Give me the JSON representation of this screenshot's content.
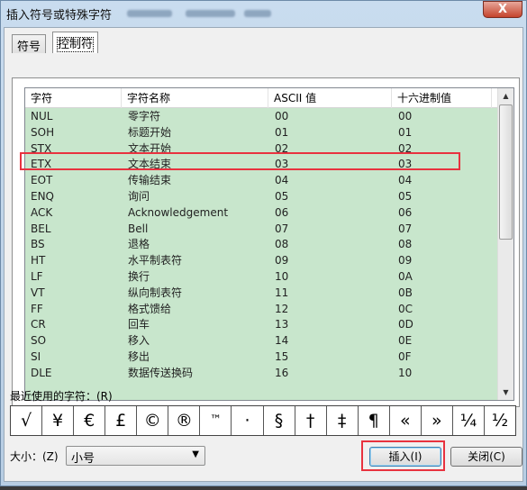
{
  "window": {
    "title": "插入符号或特殊字符",
    "close_label": "X"
  },
  "tabs": [
    {
      "label": "符号",
      "active": false
    },
    {
      "label": "控制符",
      "active": true
    }
  ],
  "list": {
    "columns": [
      "字符",
      "字符名称",
      "ASCII 值",
      "十六进制值"
    ],
    "rows": [
      [
        "NUL",
        "零字符",
        "00",
        "00"
      ],
      [
        "SOH",
        "标题开始",
        "01",
        "01"
      ],
      [
        "STX",
        "文本开始",
        "02",
        "02"
      ],
      [
        "ETX",
        "文本结束",
        "03",
        "03"
      ],
      [
        "EOT",
        "传输结束",
        "04",
        "04"
      ],
      [
        "ENQ",
        "询问",
        "05",
        "05"
      ],
      [
        "ACK",
        "Acknowledgement",
        "06",
        "06"
      ],
      [
        "BEL",
        "Bell",
        "07",
        "07"
      ],
      [
        "BS",
        "退格",
        "08",
        "08"
      ],
      [
        "HT",
        "水平制表符",
        "09",
        "09"
      ],
      [
        "LF",
        "换行",
        "10",
        "0A"
      ],
      [
        "VT",
        "纵向制表符",
        "11",
        "0B"
      ],
      [
        "FF",
        "格式馈给",
        "12",
        "0C"
      ],
      [
        "CR",
        "回车",
        "13",
        "0D"
      ],
      [
        "SO",
        "移入",
        "14",
        "0E"
      ],
      [
        "SI",
        "移出",
        "15",
        "0F"
      ],
      [
        "DLE",
        "数据传送换码",
        "16",
        "10"
      ]
    ],
    "highlighted_row": "EOT",
    "row_background": "#c8e6cc",
    "highlight_color": "#e8323f"
  },
  "recent": {
    "label": "最近使用的字符：(R)",
    "chars": [
      "√",
      "¥",
      "€",
      "£",
      "©",
      "®",
      "™",
      "·",
      "§",
      "†",
      "‡",
      "¶",
      "«",
      "»",
      "¼",
      "½"
    ]
  },
  "size": {
    "label": "大小：(Z)",
    "value": "小号"
  },
  "buttons": {
    "insert": "插入(I)",
    "close": "关闭(C)"
  }
}
